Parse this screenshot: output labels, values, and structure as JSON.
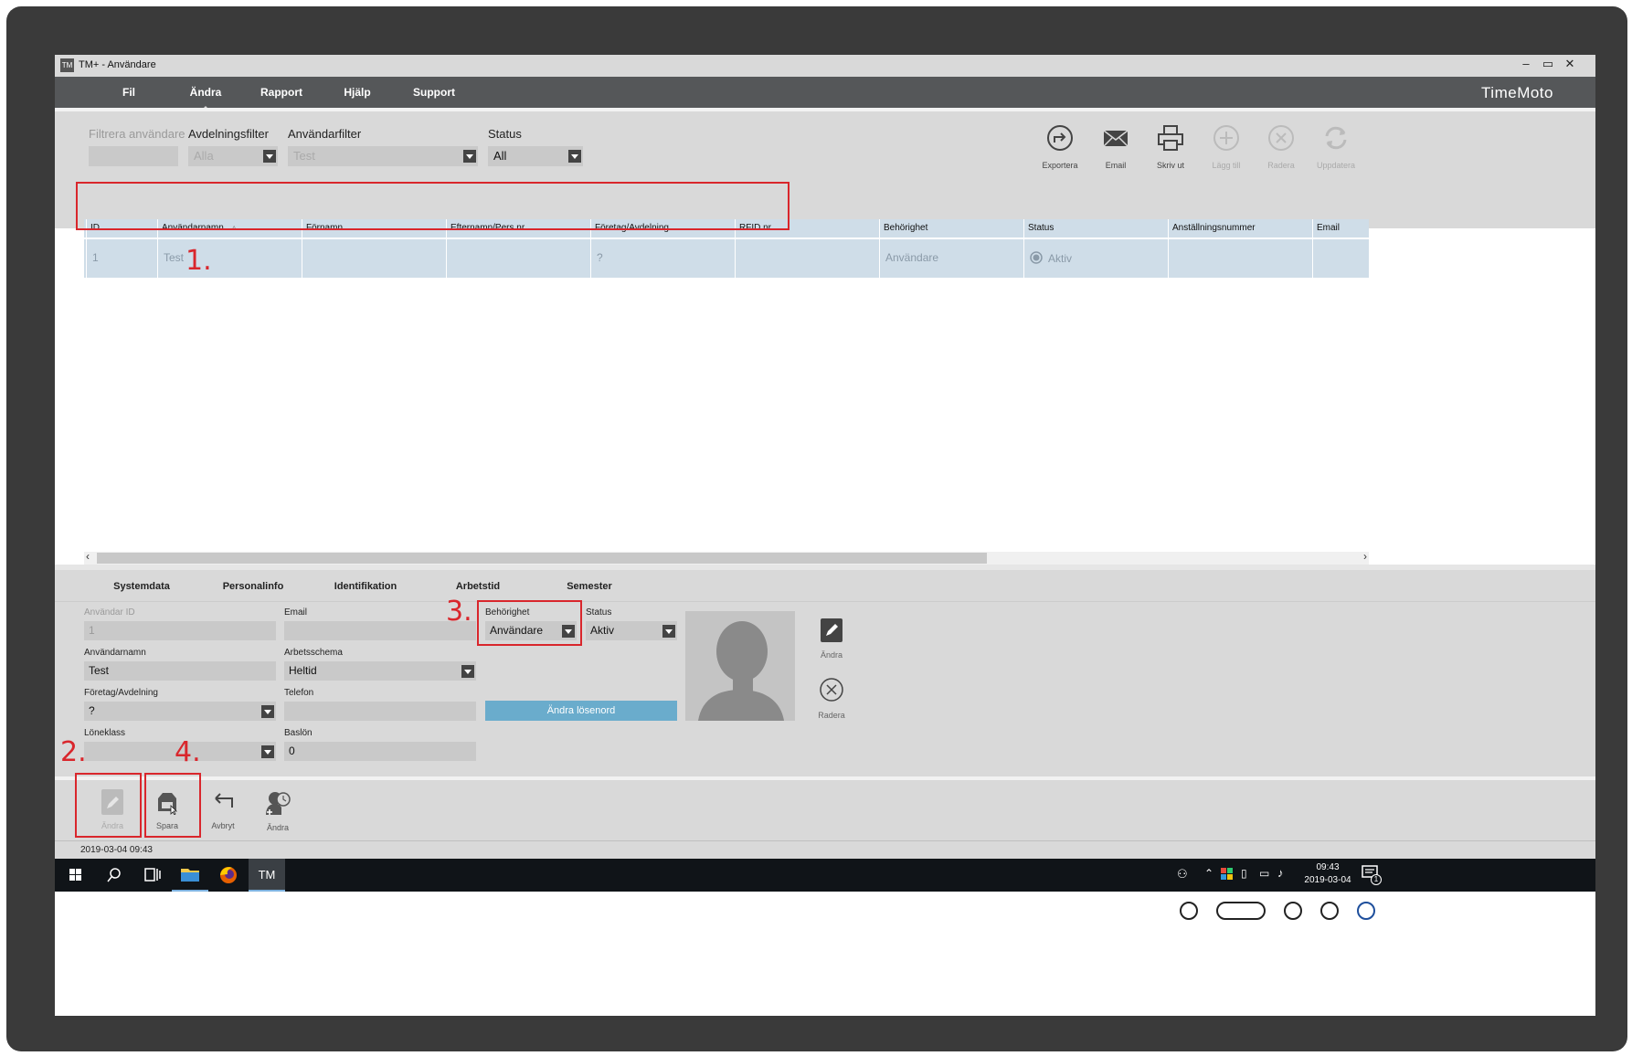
{
  "window": {
    "title": "TM+ - Användare",
    "app_icon": "TM",
    "minimize": "–",
    "restore": "▭",
    "close": "✕"
  },
  "menu": {
    "items": [
      "Fil",
      "Ändra",
      "Rapport",
      "Hjälp",
      "Support"
    ],
    "active": "Ändra",
    "brand": "TimeMoto"
  },
  "filters": {
    "user_filter_label": "Filtrera användare",
    "department_filter_label": "Avdelningsfilter",
    "department_filter_value": "Alla",
    "user_type_filter_label": "Användarfilter",
    "user_type_filter_value": "Test",
    "status_label": "Status",
    "status_value": "All"
  },
  "toolbar": [
    {
      "label": "Exportera",
      "icon": "export-icon",
      "enabled": true
    },
    {
      "label": "Email",
      "icon": "email-icon",
      "enabled": true
    },
    {
      "label": "Skriv ut",
      "icon": "print-icon",
      "enabled": true
    },
    {
      "label": "Lägg till",
      "icon": "add-icon",
      "enabled": false
    },
    {
      "label": "Radera",
      "icon": "delete-icon",
      "enabled": false
    },
    {
      "label": "Uppdatera",
      "icon": "refresh-icon",
      "enabled": false
    }
  ],
  "table": {
    "columns": [
      "ID",
      "Användarnamn",
      "Förnamn",
      "Efternamn/Pers.nr.",
      "Företag/Avdelning",
      "RFID nr",
      "Behörighet",
      "Status",
      "Anställningsnummer",
      "Email"
    ],
    "sort_indicator": "▵",
    "rows": [
      {
        "id": "1",
        "username": "Test",
        "first_name": "",
        "last_name": "",
        "department": "?",
        "rfid": "",
        "permission": "Användare",
        "status": "Aktiv",
        "employee_no": "",
        "email": ""
      }
    ]
  },
  "annotations": {
    "n1": "1.",
    "n2": "2.",
    "n3": "3.",
    "n4": "4."
  },
  "detail_tabs": [
    "Systemdata",
    "Personalinfo",
    "Identifikation",
    "Arbetstid",
    "Semester"
  ],
  "detail": {
    "user_id_label": "Användar ID",
    "user_id_value": "1",
    "username_label": "Användarnamn",
    "username_value": "Test",
    "department_label": "Företag/Avdelning",
    "department_value": "?",
    "salary_class_label": "Löneklass",
    "salary_class_value": "",
    "email_label": "Email",
    "email_value": "",
    "schedule_label": "Arbetsschema",
    "schedule_value": "Heltid",
    "phone_label": "Telefon",
    "phone_value": "",
    "base_salary_label": "Baslön",
    "base_salary_value": "0",
    "permission_label": "Behörighet",
    "permission_value": "Användare",
    "status_label": "Status",
    "status_value": "Aktiv",
    "change_password": "Ändra lösenord",
    "photo_edit": "Ändra",
    "photo_delete": "Radera"
  },
  "actions": [
    {
      "label": "Ändra",
      "icon": "pencil-icon",
      "enabled": false
    },
    {
      "label": "Spara",
      "icon": "save-icon",
      "enabled": true
    },
    {
      "label": "Avbryt",
      "icon": "undo-icon",
      "enabled": true
    },
    {
      "label": "Ändra",
      "icon": "clock-user-icon",
      "enabled": true
    }
  ],
  "status_bar": "2019-03-04 09:43",
  "taskbar": {
    "time": "09:43",
    "date": "2019-03-04",
    "notification_count": "1",
    "active_app": "TM"
  }
}
